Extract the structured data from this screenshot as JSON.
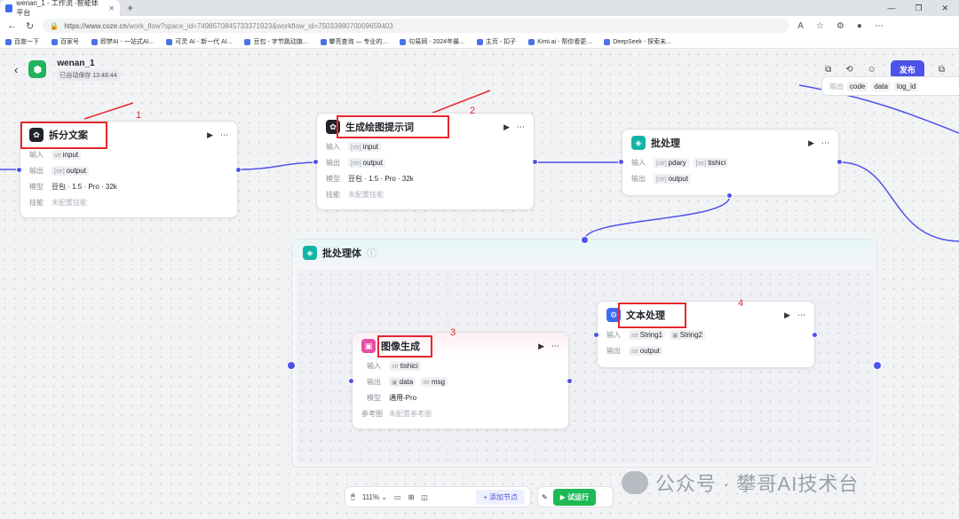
{
  "browser": {
    "tab_title": "wenan_1 - 工作流 -智能体平台",
    "url_host": "https://www.coze.cn",
    "url_path": "/work_flow?space_id=7498570845733371923&workflow_id=7503398070009659403",
    "bookmarks": [
      "百度一下",
      "百家号",
      "即梦AI - 一站式AI...",
      "可灵 AI - 新一代 AI...",
      "豆包 - 字节跳动旗...",
      "攀亮查询 — 专业的...",
      "句易网 - 2024年最...",
      "主页 - 扣子",
      "Kimi.ai - 帮你看更...",
      "DeepSeek - 探索未..."
    ]
  },
  "app": {
    "name": "wenan_1",
    "saved": "已自动保存 13:48:44",
    "publish_label": "发布"
  },
  "labels": {
    "in": "输入",
    "out": "输出",
    "model": "模型",
    "skill": "技能",
    "ref": "参考图"
  },
  "nodes": {
    "split": {
      "title": "拆分文案",
      "in": [
        "input"
      ],
      "out": [
        "output"
      ],
      "model": "豆包 · 1.5 · Pro · 32k",
      "skill": "未配置技能"
    },
    "prompt": {
      "title": "生成绘图提示词",
      "in": [
        "input"
      ],
      "out": [
        "output"
      ],
      "model": "豆包 · 1.5 · Pro · 32k",
      "skill": "未配置技能"
    },
    "batch": {
      "title": "批处理",
      "in": [
        "pdary",
        "tishici"
      ],
      "out": [
        "output"
      ]
    },
    "image": {
      "title": "图像生成",
      "in": [
        "tishici"
      ],
      "out": [
        "data",
        "msg"
      ],
      "model": "通用-Pro",
      "ref": "未配置参考图"
    },
    "text": {
      "title": "文本处理",
      "in": [
        "String1",
        "String2"
      ],
      "out": [
        "output"
      ]
    }
  },
  "group": {
    "title": "批处理体"
  },
  "corner_card": {
    "label": "输出",
    "items": [
      "code",
      "data",
      "log_id"
    ]
  },
  "annotations": [
    "1",
    "2",
    "3",
    "4"
  ],
  "toolbar": {
    "zoom": "111%",
    "add_node": "添加节点",
    "run": "试运行"
  },
  "watermark": "公众号 · 攀哥AI技术台"
}
